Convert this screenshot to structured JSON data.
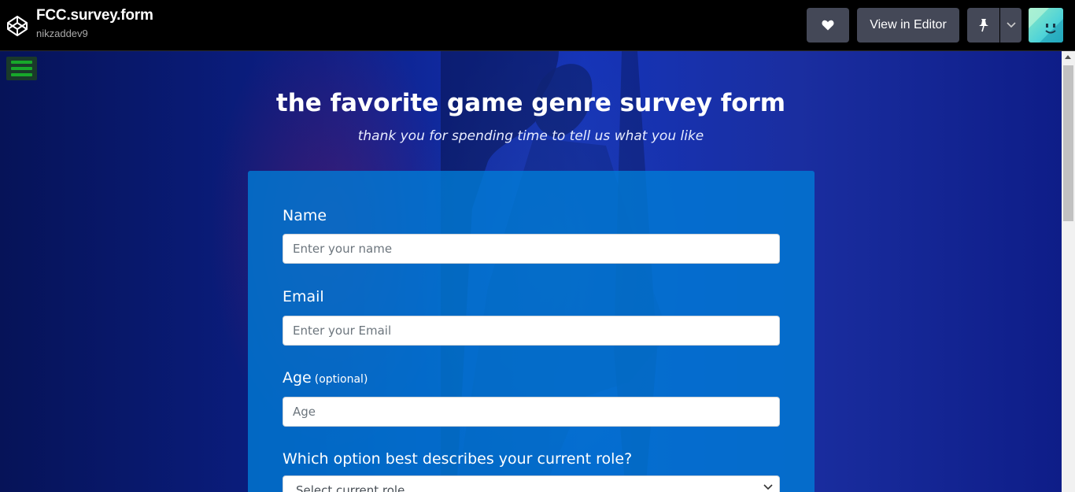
{
  "header": {
    "title": "FCC.survey.form",
    "author": "nikzaddev9",
    "logo_icon": "codepen-logo-icon",
    "heart_icon": "heart-icon",
    "editor_label": "View in Editor",
    "pin_icon": "pin-icon",
    "dropdown_icon": "chevron-down-icon"
  },
  "page": {
    "title": "the favorite game genre survey form",
    "description": "thank you for spending time to tell us what you like"
  },
  "form": {
    "name_label": "Name",
    "name_placeholder": "Enter your name",
    "email_label": "Email",
    "email_placeholder": "Enter your Email",
    "age_label": "Age",
    "age_optional": "(optional)",
    "age_placeholder": "Age",
    "role_label": "Which option best describes your current role?",
    "role_selected": "Select current role"
  },
  "colors": {
    "card": "#0a7fd6",
    "menu_icon": "#17a82a",
    "topbar": "#000000",
    "button": "#444857"
  }
}
